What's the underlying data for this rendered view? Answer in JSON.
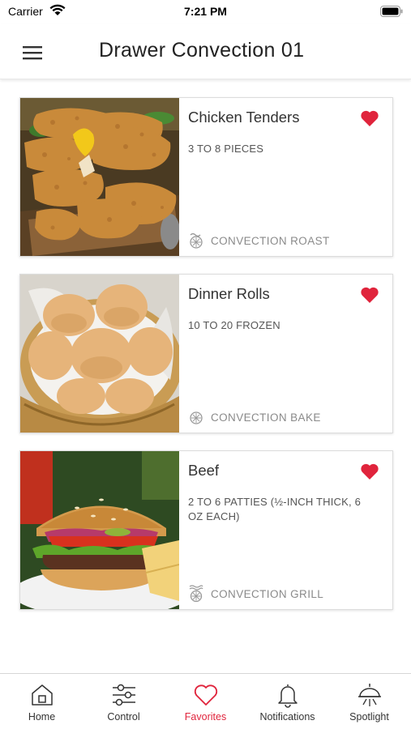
{
  "status_bar": {
    "carrier": "Carrier",
    "time": "7:21 PM"
  },
  "header": {
    "title": "Drawer Convection 01",
    "menu_icon": "hamburger-menu-icon"
  },
  "colors": {
    "accent": "#e0243c",
    "text": "#333333",
    "muted": "#8a8a8a"
  },
  "recipes": [
    {
      "title": "Chicken Tenders",
      "subtitle": "3 TO 8 PIECES",
      "mode": "CONVECTION ROAST",
      "favorite": true,
      "image": "chicken-tenders-photo"
    },
    {
      "title": "Dinner Rolls",
      "subtitle": "10 TO 20 FROZEN",
      "mode": "CONVECTION BAKE",
      "favorite": true,
      "image": "dinner-rolls-photo"
    },
    {
      "title": "Beef",
      "subtitle": "2 TO 6 PATTIES (½-INCH THICK, 6 OZ EACH)",
      "mode": "CONVECTION GRILL",
      "favorite": true,
      "image": "burger-photo"
    }
  ],
  "tabs": [
    {
      "label": "Home",
      "icon": "home-icon",
      "active": false
    },
    {
      "label": "Control",
      "icon": "sliders-icon",
      "active": false
    },
    {
      "label": "Favorites",
      "icon": "heart-icon",
      "active": true
    },
    {
      "label": "Notifications",
      "icon": "bell-icon",
      "active": false
    },
    {
      "label": "Spotlight",
      "icon": "spotlight-icon",
      "active": false
    }
  ]
}
